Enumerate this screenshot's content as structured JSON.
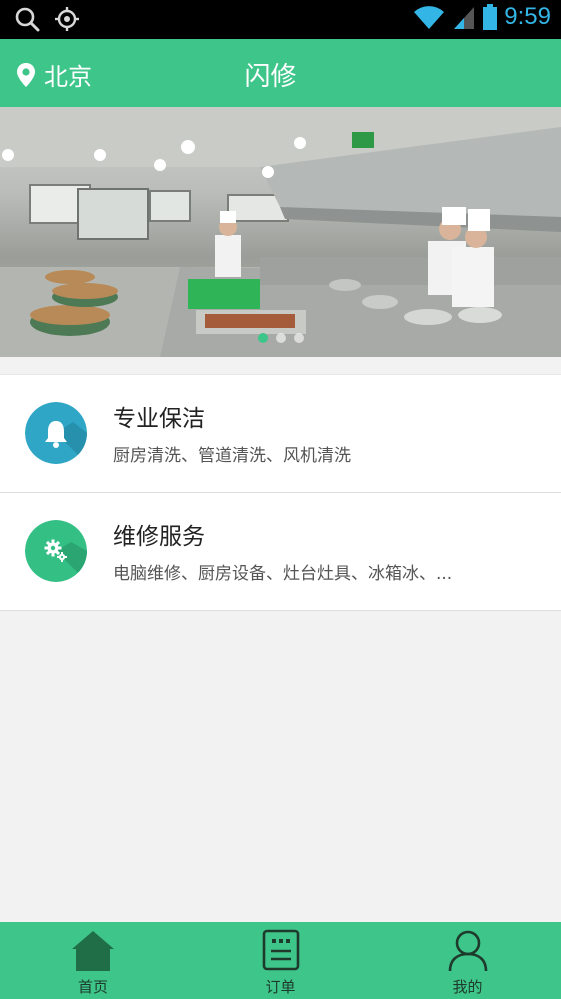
{
  "status_bar": {
    "time": "9:59",
    "icons": [
      "search-icon",
      "locate-icon",
      "wifi-icon",
      "signal-icon",
      "battery-icon"
    ]
  },
  "header": {
    "location": "北京",
    "title": "闪修",
    "location_icon": "map-pin-icon"
  },
  "banner": {
    "slides": 3,
    "active_slide": 1
  },
  "services": [
    {
      "title": "专业保洁",
      "description": "厨房清洗、管道清洗、风机清洗",
      "icon": "bell-icon",
      "color": "#2fa6c6"
    },
    {
      "title": "维修服务",
      "description": "电脑维修、厨房设备、灶台灶具、冰箱冰、...",
      "icon": "gears-icon",
      "color": "#34bf85"
    }
  ],
  "bottom_nav": [
    {
      "label": "首页",
      "icon": "home-icon",
      "active": true
    },
    {
      "label": "订单",
      "icon": "order-icon",
      "active": false
    },
    {
      "label": "我的",
      "icon": "user-icon",
      "active": false
    }
  ],
  "colors": {
    "accent": "#3ec58a",
    "status_text": "#33b5e5",
    "page_bg": "#f2f2f2"
  }
}
